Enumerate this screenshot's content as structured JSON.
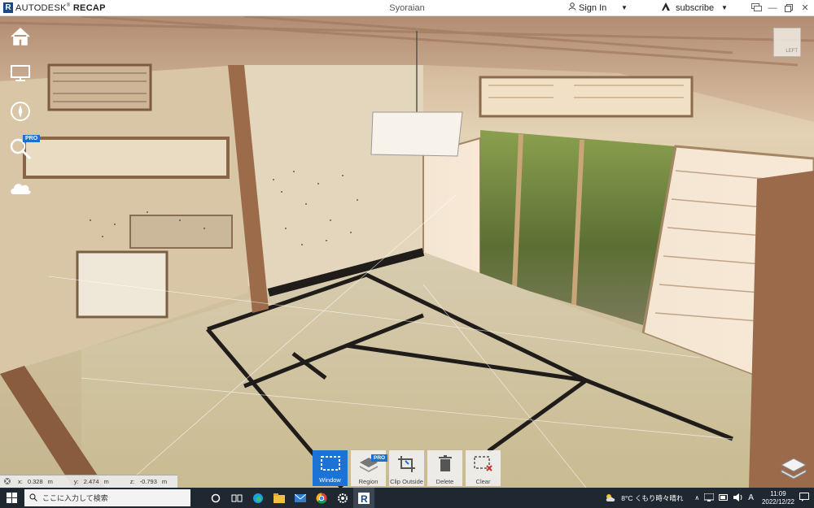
{
  "app": {
    "logo_letter": "R",
    "brand_prefix": "AUTODESK",
    "brand_product": "RECAP",
    "document_title": "Syoraian",
    "signin_label": "Sign In",
    "subscribe_label": "subscribe"
  },
  "viewcube": {
    "face_label": "LEFT"
  },
  "left_nav": {
    "pro_badge": "PRO"
  },
  "coordinates": {
    "x_label": "x:",
    "x_value": "0.328",
    "x_unit": "m",
    "y_label": "y:",
    "y_value": "2.474",
    "y_unit": "m",
    "z_label": "z:",
    "z_value": "-0.793",
    "z_unit": "m"
  },
  "toolbar": {
    "window_label": "Window",
    "region_label": "Region",
    "region_badge": "PRO",
    "clip_outside_label": "Clip Outside",
    "delete_label": "Delete",
    "clear_label": "Clear"
  },
  "taskbar": {
    "search_placeholder": "ここに入力して検索",
    "weather_text": "8°C くもり時々晴れ",
    "ime_label": "A",
    "time": "11:09",
    "date": "2022/12/22"
  },
  "colors": {
    "accent": "#1d72d6",
    "taskbar": "#1f2730",
    "brand": "#1c4a80"
  }
}
